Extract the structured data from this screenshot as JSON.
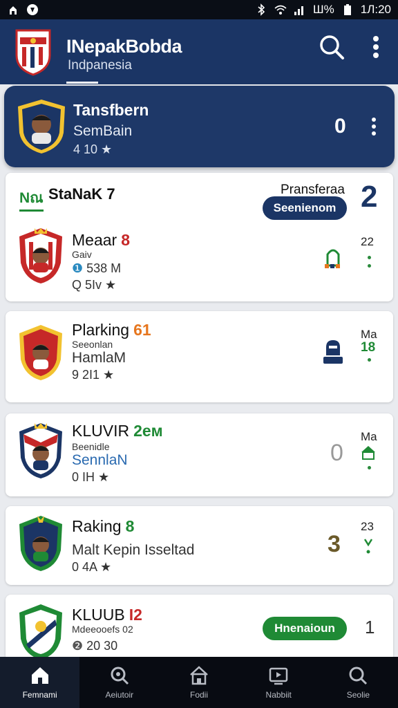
{
  "status_bar": {
    "time": "1Л:20",
    "battery": "Ш%"
  },
  "app_bar": {
    "title": "INepakBobda",
    "subtitle": "Indpanesia"
  },
  "featured": {
    "title": "Tansfbern",
    "subtitle": "SemBain",
    "meta": "4 10 ★",
    "score": "0"
  },
  "section": {
    "tag": "Nณ",
    "title": "StaNaK 7",
    "label": "Pransferaa",
    "pill": "Seenienom",
    "score": "2"
  },
  "cards": [
    {
      "name": "Meaar",
      "badge": "8",
      "line2": "Gaiv",
      "meta1": " 538 M",
      "meta2": "Q 5Iv ★",
      "right_top": "22"
    },
    {
      "name": "Plarking",
      "badge": "61",
      "line2": "Seeonlan",
      "line3": "HamlaM",
      "meta": "9 2I1 ★",
      "right_top": "Ma",
      "right_mid": "18"
    },
    {
      "name": "KLUVIR",
      "badge": "2eм",
      "line2": "Beenidle",
      "line3": "SennlaN",
      "meta": "0 IH ★",
      "score": "0",
      "right_top": "Ma"
    },
    {
      "name": "Raking",
      "badge": "8",
      "line2": "Malt Kepin Isseltad",
      "meta": "0 4A ★",
      "score": "3",
      "right_top": "23"
    },
    {
      "name": "KLUUB",
      "badge": "I2",
      "line2": "Mdeeooefs 02",
      "meta": "20 30",
      "pill": "Hnenaioun",
      "right_score": "1"
    }
  ],
  "nav": [
    {
      "label": "Femnami",
      "icon": "home-icon"
    },
    {
      "label": "Aeiutoir",
      "icon": "search-icon"
    },
    {
      "label": "Fodii",
      "icon": "house-icon"
    },
    {
      "label": "Nabbiit",
      "icon": "video-icon"
    },
    {
      "label": "Seolie",
      "icon": "search-icon"
    }
  ],
  "colors": {
    "navy": "#1b3565",
    "green": "#1f8a35",
    "red": "#c62828",
    "orange": "#e6761e"
  }
}
